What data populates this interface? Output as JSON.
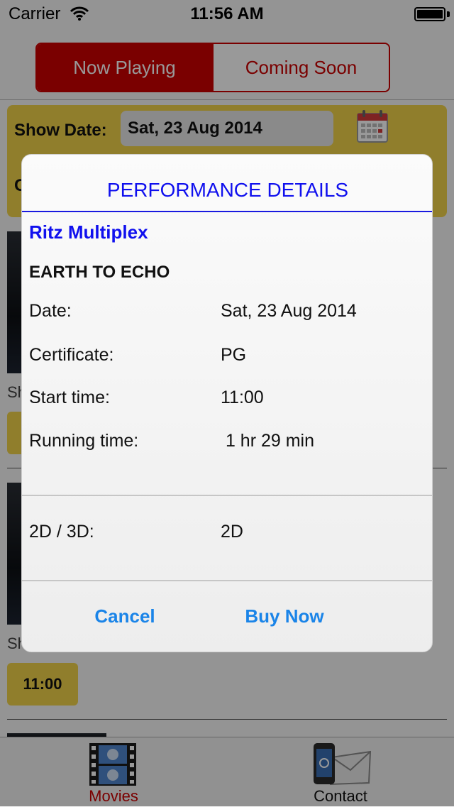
{
  "status_bar": {
    "carrier": "Carrier",
    "time": "11:56 AM"
  },
  "segmented": {
    "now_playing": "Now Playing",
    "coming_soon": "Coming Soon"
  },
  "filter": {
    "show_date_label": "Show Date:",
    "show_date_value": "Sat, 23 Aug 2014",
    "second_row_partial": "C"
  },
  "list": {
    "partial_label": "Sh",
    "showtimes": [
      "11:00"
    ]
  },
  "modal": {
    "title": "PERFORMANCE DETAILS",
    "cinema": "Ritz Multiplex",
    "movie": "EARTH TO ECHO",
    "rows": [
      {
        "label": "Date:",
        "value": "Sat, 23 Aug 2014"
      },
      {
        "label": "Certificate:",
        "value": "PG"
      },
      {
        "label": "Start time:",
        "value": "11:00"
      },
      {
        "label": "Running time:",
        "value": " 1 hr 29 min"
      }
    ],
    "format": {
      "label": "2D / 3D:",
      "value": "2D"
    },
    "cancel": "Cancel",
    "buy": "Buy Now"
  },
  "tabbar": {
    "movies": "Movies",
    "contact": "Contact",
    "movies_icon": "film-strip-icon",
    "contact_icon": "phone-mail-icon"
  },
  "colors": {
    "accent": "#cc0000",
    "panel": "#f1d34a",
    "link": "#1a84e8",
    "title_blue": "#1010ee"
  }
}
